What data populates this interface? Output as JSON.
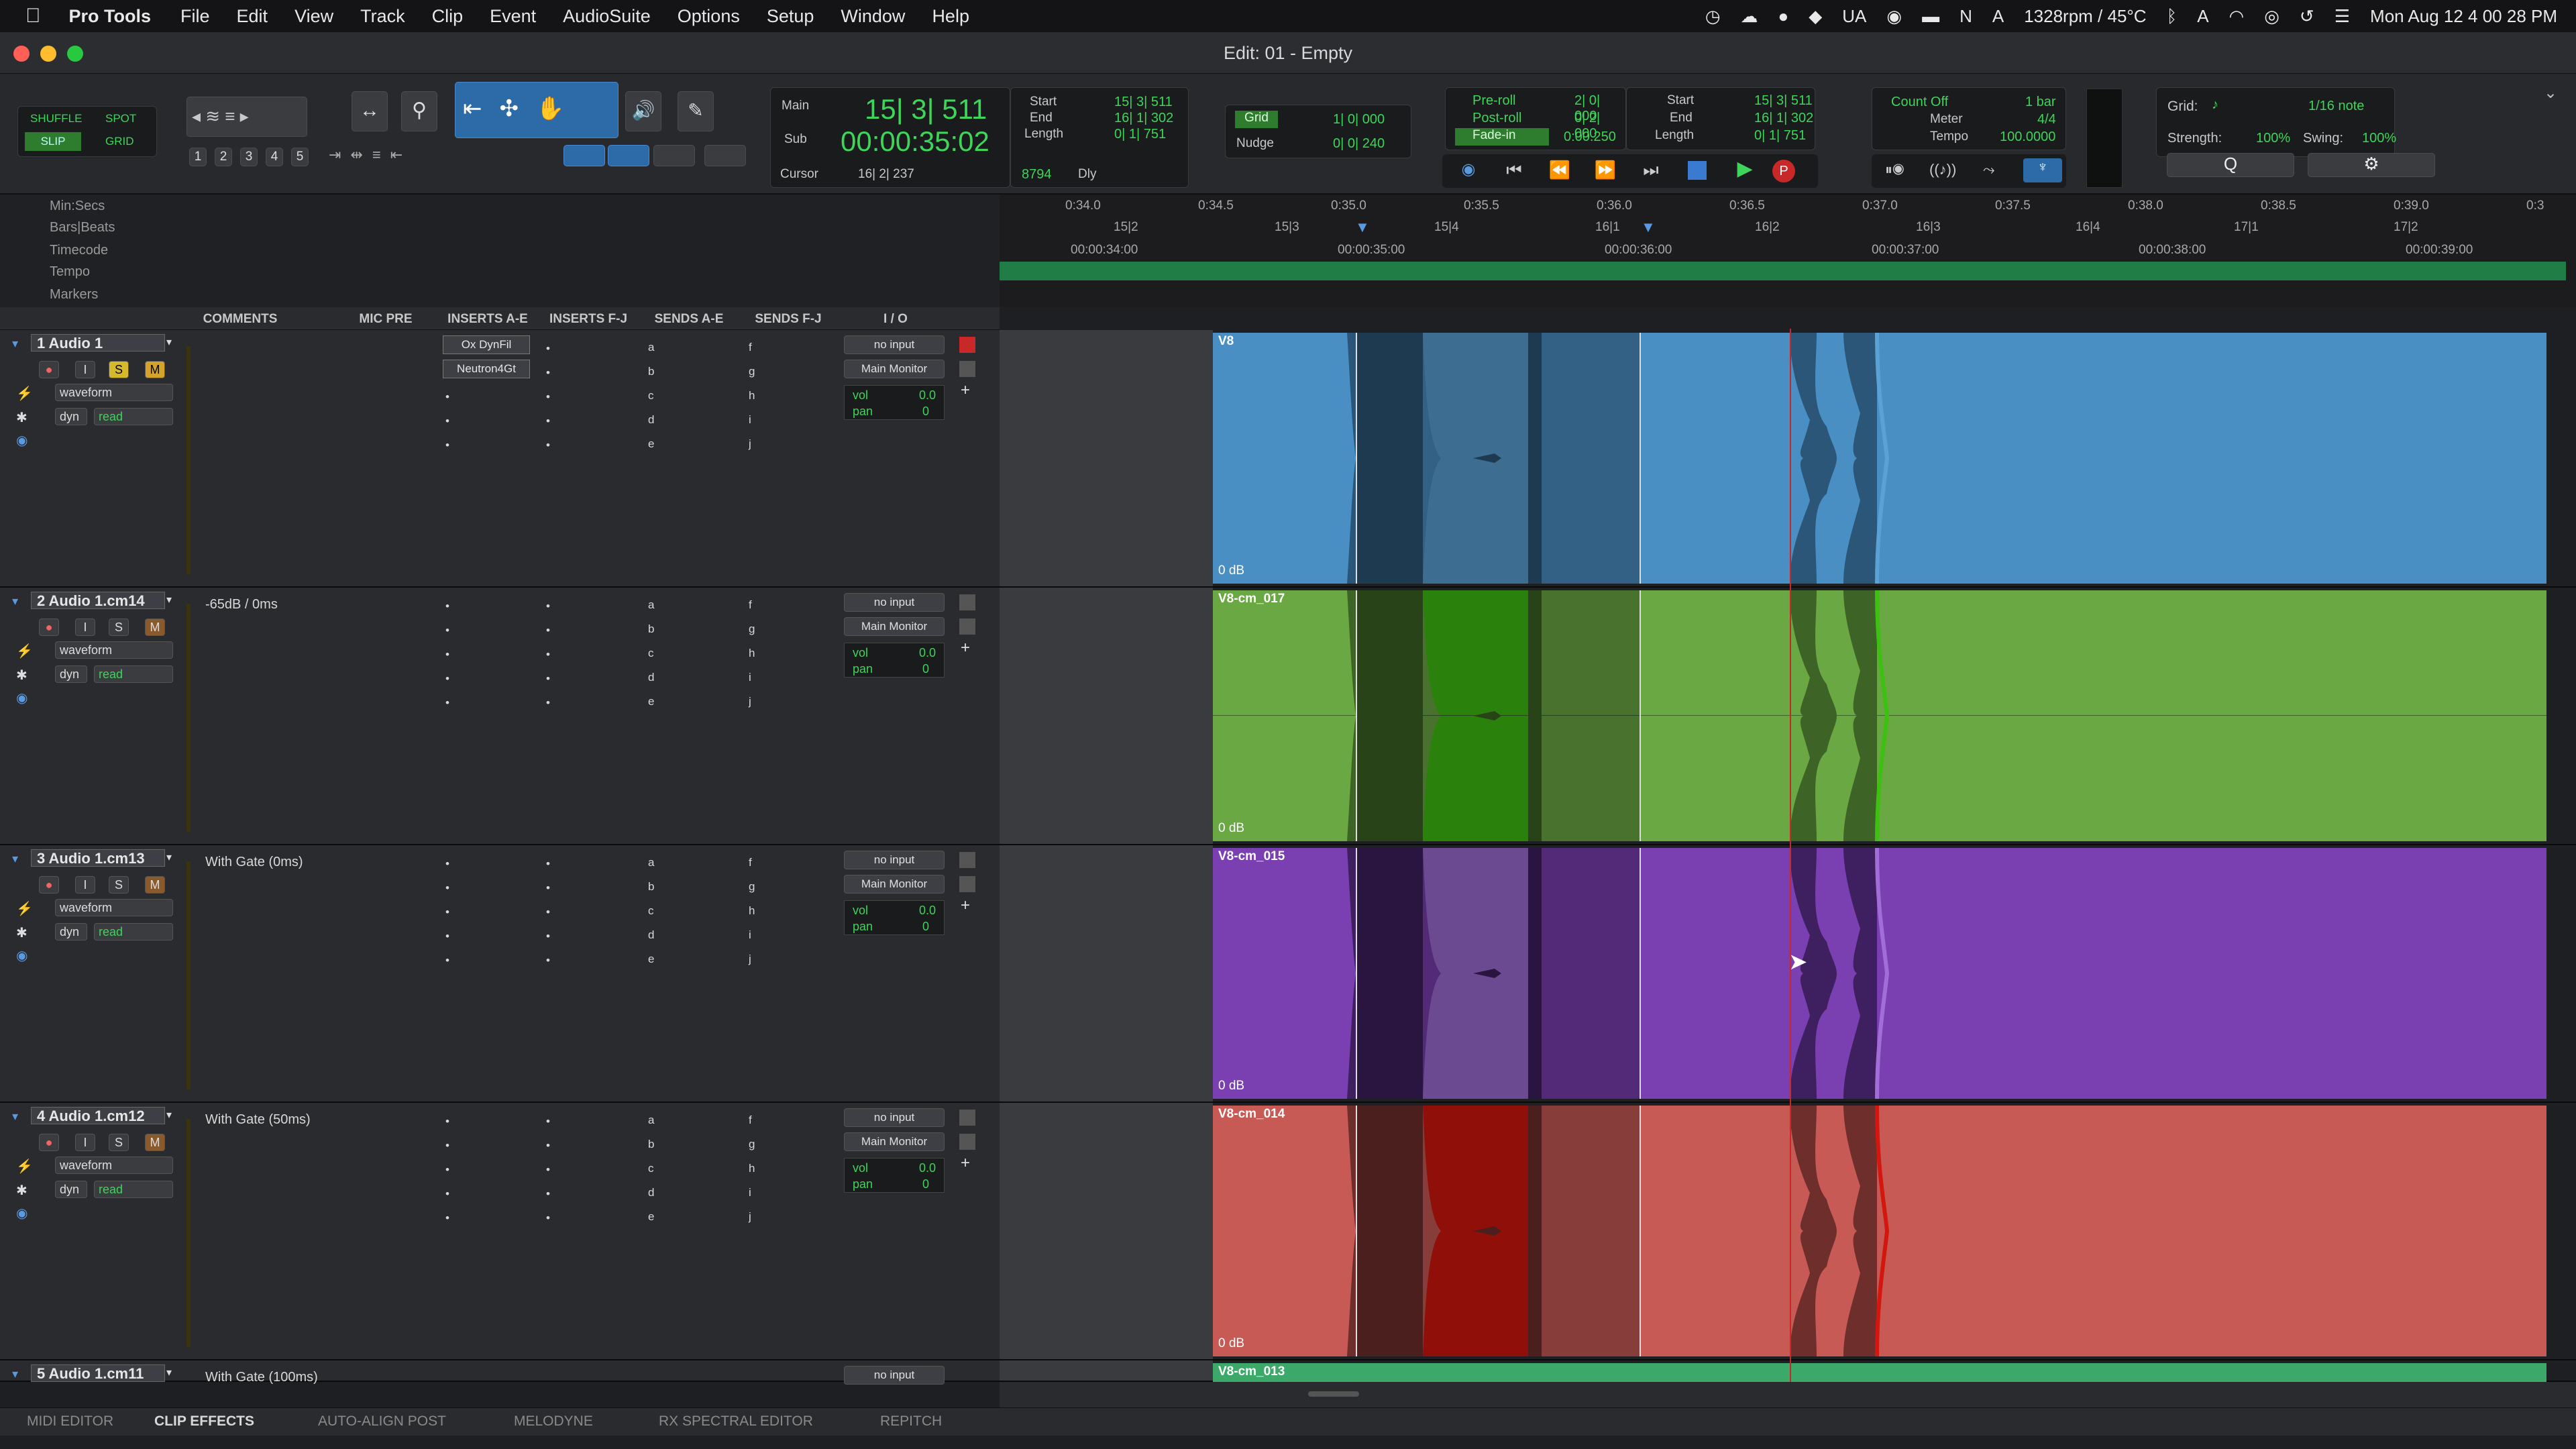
{
  "menubar": {
    "apple": "",
    "app": "Pro Tools",
    "items": [
      "File",
      "Edit",
      "View",
      "Track",
      "Clip",
      "Event",
      "AudioSuite",
      "Options",
      "Setup",
      "Window",
      "Help"
    ],
    "status": {
      "ua": "UA",
      "fan": "1328rpm / 45°C",
      "clock": "Mon Aug 12  4 00 28 PM"
    }
  },
  "window": {
    "title": "Edit: 01 - Empty"
  },
  "toolbar": {
    "modes": {
      "shuffle": "SHUFFLE",
      "spot": "SPOT",
      "slip": "SLIP",
      "grid": "GRID"
    },
    "zoom_presets": [
      "1",
      "2",
      "3",
      "4",
      "5"
    ],
    "counter": {
      "main_label": "Main",
      "main": "15| 3| 511",
      "sub_label": "Sub",
      "sub": "00:00:35:02",
      "start_label": "Start",
      "start": "15| 3| 511",
      "end_label": "End",
      "end": "16| 1| 302",
      "length_label": "Length",
      "length": "0| 1| 751",
      "cursor_label": "Cursor",
      "cursor": "16| 2| 237",
      "samples": "8794",
      "dly": "Dly"
    },
    "grid_nudge": {
      "grid_label": "Grid",
      "grid": "1| 0| 000",
      "nudge_label": "Nudge",
      "nudge": "0| 0| 240"
    },
    "preroll": {
      "pre_label": "Pre-roll",
      "pre": "2| 0| 000",
      "post_label": "Post-roll",
      "post": "0| 2| 000",
      "fade_label": "Fade-in",
      "fade": "0:00.250",
      "start_label": "Start",
      "start": "15| 3| 511",
      "end_label": "End",
      "end": "16| 1| 302",
      "length_label": "Length",
      "length": "0| 1| 751"
    },
    "midi": {
      "countoff_label": "Count Off",
      "countoff": "1 bar",
      "meter_label": "Meter",
      "meter": "4/4",
      "tempo_label": "Tempo",
      "tempo": "100.0000"
    },
    "quantize": {
      "grid_label": "Grid:",
      "grid": "1/16 note",
      "strength_label": "Strength:",
      "strength": "100%",
      "swing_label": "Swing:",
      "swing": "100%"
    }
  },
  "rulers": {
    "labels": [
      "Min:Secs",
      "Bars|Beats",
      "Timecode",
      "Tempo",
      "Markers"
    ],
    "minsecs": [
      "0:34.0",
      "0:34.5",
      "0:35.0",
      "0:35.5",
      "0:36.0",
      "0:36.5",
      "0:37.0",
      "0:37.5",
      "0:38.0",
      "0:38.5",
      "0:39.0",
      "0:3"
    ],
    "bars": [
      "15|2",
      "15|3",
      "15|4",
      "16|1",
      "16|2",
      "16|3",
      "16|4",
      "17|1",
      "17|2"
    ],
    "timecode": [
      "00:00:34:00",
      "00:00:35:00",
      "00:00:36:00",
      "00:00:37:00",
      "00:00:38:00",
      "00:00:39:00"
    ]
  },
  "columns": [
    "COMMENTS",
    "MIC PRE",
    "INSERTS A-E",
    "INSERTS F-J",
    "SENDS A-E",
    "SENDS F-J",
    "I / O"
  ],
  "tracks": [
    {
      "num": "1",
      "name": "Audio 1",
      "comment": "",
      "inserts": [
        "Ox DynFil",
        "Neutron4Gt"
      ],
      "view": "waveform",
      "auto": "read",
      "dyn": "dyn",
      "input": "no input",
      "output": "Main Monitor",
      "vol_label": "vol",
      "vol": "0.0",
      "pan_label": "pan",
      "pan": "0",
      "clip": "V8",
      "db": "0 dB",
      "color": "#4a8fc4",
      "dark": "#2c5678",
      "wave": "#5aa2d6"
    },
    {
      "num": "2",
      "name": "Audio 1.cm14",
      "comment": "-65dB / 0ms",
      "inserts": [],
      "view": "waveform",
      "auto": "read",
      "dyn": "dyn",
      "input": "no input",
      "output": "Main Monitor",
      "vol_label": "vol",
      "vol": "0.0",
      "pan_label": "pan",
      "pan": "0",
      "clip": "V8-cm_017",
      "db": "0 dB",
      "color": "#6aa843",
      "dark": "#3d6326",
      "wave": "#3ec012"
    },
    {
      "num": "3",
      "name": "Audio 1.cm13",
      "comment": "With Gate (0ms)",
      "inserts": [],
      "view": "waveform",
      "auto": "read",
      "dyn": "dyn",
      "input": "no input",
      "output": "Main Monitor",
      "vol_label": "vol",
      "vol": "0.0",
      "pan_label": "pan",
      "pan": "0",
      "clip": "V8-cm_015",
      "db": "0 dB",
      "color": "#7a3fb0",
      "dark": "#3e2060",
      "wave": "#a06ed6"
    },
    {
      "num": "4",
      "name": "Audio 1.cm12",
      "comment": "With Gate (50ms)",
      "inserts": [],
      "view": "waveform",
      "auto": "read",
      "dyn": "dyn",
      "input": "no input",
      "output": "Main Monitor",
      "vol_label": "vol",
      "vol": "0.0",
      "pan_label": "pan",
      "pan": "0",
      "clip": "V8-cm_014",
      "db": "0 dB",
      "color": "#c85a55",
      "dark": "#6e2e2b",
      "wave": "#d4170e"
    },
    {
      "num": "5",
      "name": "Audio 1.cm11",
      "comment": "With Gate (100ms)",
      "input": "no input",
      "clip": "V8-cm_013",
      "color": "#3ca96a"
    }
  ],
  "sends_ae": [
    "a",
    "b",
    "c",
    "d",
    "e"
  ],
  "sends_fj": [
    "f",
    "g",
    "h",
    "i",
    "j"
  ],
  "bottom_tabs": [
    "MIDI EDITOR",
    "CLIP EFFECTS",
    "AUTO-ALIGN POST",
    "MELODYNE",
    "RX SPECTRAL EDITOR",
    "REPITCH"
  ]
}
